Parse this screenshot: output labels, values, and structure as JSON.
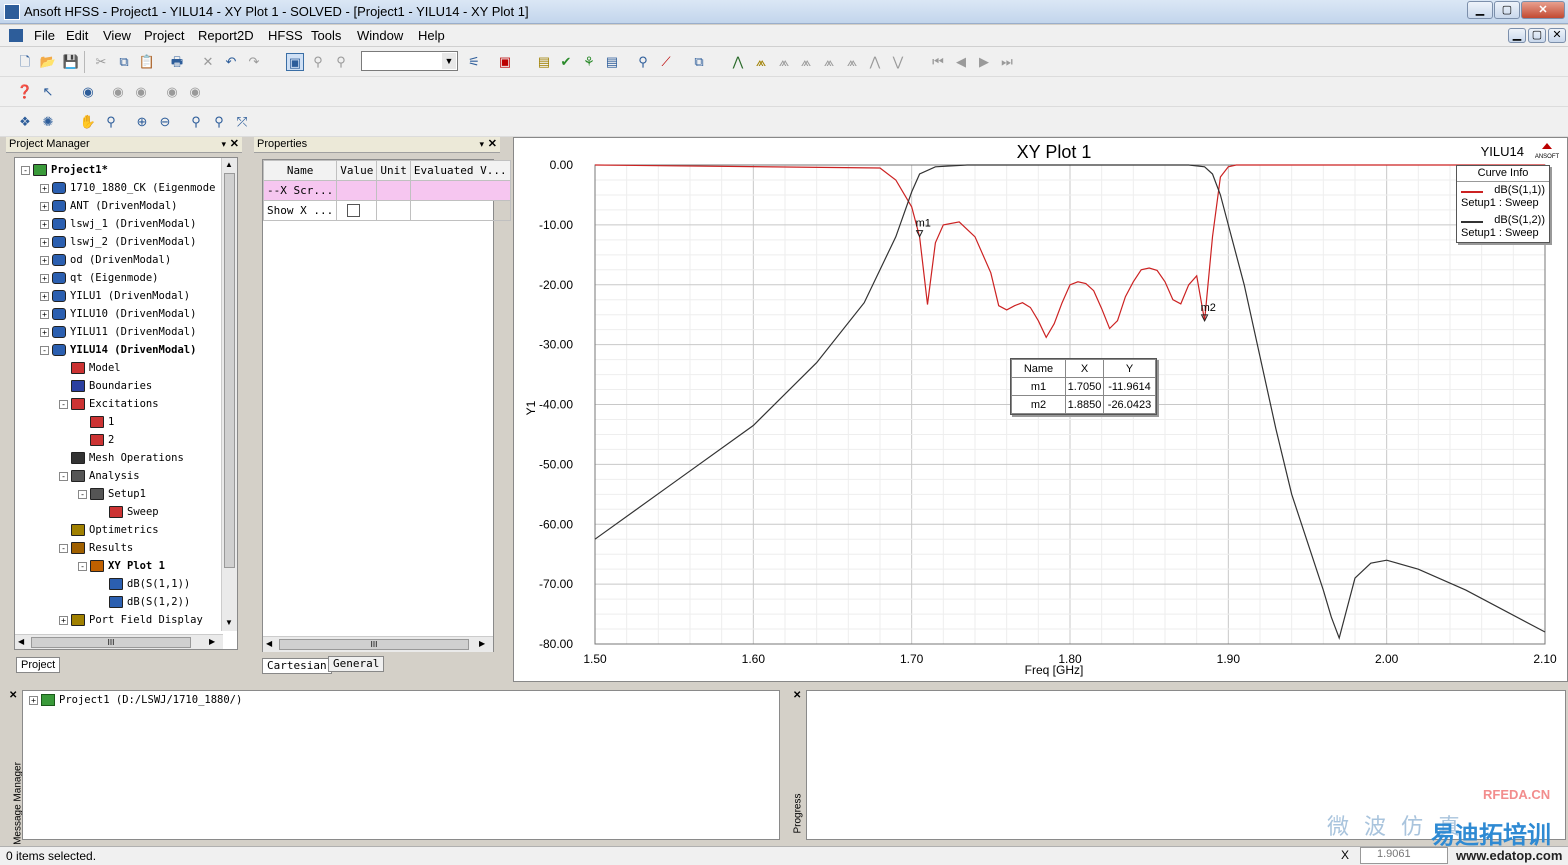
{
  "window": {
    "title": "Ansoft HFSS - Project1 - YILU14 - XY Plot 1 - SOLVED - [Project1 - YILU14 - XY Plot 1]"
  },
  "menu": [
    "File",
    "Edit",
    "View",
    "Project",
    "Report2D",
    "HFSS",
    "Tools",
    "Window",
    "Help"
  ],
  "project_manager": {
    "title": "Project Manager",
    "tab": "Project",
    "items": [
      {
        "label": "Project1*",
        "bold": true,
        "level": 0,
        "exp": "-"
      },
      {
        "label": "1710_1880_CK (Eigenmode",
        "level": 1,
        "exp": "+"
      },
      {
        "label": "ANT (DrivenModal)",
        "level": 1,
        "exp": "+"
      },
      {
        "label": "lswj_1 (DrivenModal)",
        "level": 1,
        "exp": "+"
      },
      {
        "label": "lswj_2 (DrivenModal)",
        "level": 1,
        "exp": "+"
      },
      {
        "label": "od (DrivenModal)",
        "level": 1,
        "exp": "+"
      },
      {
        "label": "qt (Eigenmode)",
        "level": 1,
        "exp": "+"
      },
      {
        "label": "YILU1 (DrivenModal)",
        "level": 1,
        "exp": "+"
      },
      {
        "label": "YILU10 (DrivenModal)",
        "level": 1,
        "exp": "+"
      },
      {
        "label": "YILU11 (DrivenModal)",
        "level": 1,
        "exp": "+"
      },
      {
        "label": "YILU14 (DrivenModal)",
        "bold": true,
        "level": 1,
        "exp": "-"
      },
      {
        "label": "Model",
        "level": 2,
        "exp": ""
      },
      {
        "label": "Boundaries",
        "level": 2,
        "exp": ""
      },
      {
        "label": "Excitations",
        "level": 2,
        "exp": "-"
      },
      {
        "label": "1",
        "level": 3,
        "exp": ""
      },
      {
        "label": "2",
        "level": 3,
        "exp": ""
      },
      {
        "label": "Mesh Operations",
        "level": 2,
        "exp": ""
      },
      {
        "label": "Analysis",
        "level": 2,
        "exp": "-"
      },
      {
        "label": "Setup1",
        "level": 3,
        "exp": "-"
      },
      {
        "label": "Sweep",
        "level": 4,
        "exp": ""
      },
      {
        "label": "Optimetrics",
        "level": 2,
        "exp": ""
      },
      {
        "label": "Results",
        "level": 2,
        "exp": "-"
      },
      {
        "label": "XY Plot 1",
        "bold": true,
        "level": 3,
        "exp": "-"
      },
      {
        "label": "dB(S(1,1))",
        "level": 4,
        "exp": ""
      },
      {
        "label": "dB(S(1,2))",
        "level": 4,
        "exp": ""
      },
      {
        "label": "Port Field Display",
        "level": 2,
        "exp": "+"
      }
    ],
    "hscroll_label": "III"
  },
  "properties": {
    "title": "Properties",
    "columns": [
      "Name",
      "Value",
      "Unit",
      "Evaluated V..."
    ],
    "rows": [
      [
        "--X Scr...",
        "",
        "",
        ""
      ],
      [
        "Show X ...",
        "",
        "",
        ""
      ]
    ],
    "tabs": [
      "Cartesian",
      "General"
    ],
    "hscroll_label": "III"
  },
  "plot": {
    "title": "XY Plot 1",
    "design": "YILU14",
    "logo": "ANSOFT",
    "xlabel": "Freq [GHz]",
    "ylabel": "Y1",
    "xticks": [
      "1.50",
      "1.60",
      "1.70",
      "1.80",
      "1.90",
      "2.00",
      "2.10"
    ],
    "yticks": [
      "0.00",
      "-10.00",
      "-20.00",
      "-30.00",
      "-40.00",
      "-50.00",
      "-60.00",
      "-70.00",
      "-80.00"
    ],
    "legend": {
      "title": "Curve Info",
      "entries": [
        {
          "name": "dB(S(1,1))",
          "sub": "Setup1 : Sweep",
          "color": "#cc2222"
        },
        {
          "name": "dB(S(1,2))",
          "sub": "Setup1 : Sweep",
          "color": "#333333"
        }
      ]
    },
    "marker_table": {
      "columns": [
        "Name",
        "X",
        "Y"
      ],
      "rows": [
        [
          "m1",
          "1.7050",
          "-11.9614"
        ],
        [
          "m2",
          "1.8850",
          "-26.0423"
        ]
      ]
    },
    "markers": [
      {
        "name": "m1"
      },
      {
        "name": "m2"
      }
    ]
  },
  "chart_data": {
    "type": "line",
    "title": "XY Plot 1",
    "xlabel": "Freq [GHz]",
    "ylabel": "Y1",
    "xlim": [
      1.5,
      2.1
    ],
    "ylim": [
      -80,
      0
    ],
    "series": [
      {
        "name": "dB(S(1,1))",
        "color": "#cc2222",
        "x": [
          1.5,
          1.68,
          1.69,
          1.7,
          1.705,
          1.71,
          1.715,
          1.72,
          1.73,
          1.74,
          1.75,
          1.755,
          1.76,
          1.765,
          1.77,
          1.775,
          1.78,
          1.785,
          1.79,
          1.795,
          1.8,
          1.805,
          1.81,
          1.815,
          1.82,
          1.825,
          1.83,
          1.835,
          1.84,
          1.845,
          1.85,
          1.855,
          1.86,
          1.865,
          1.87,
          1.875,
          1.88,
          1.885,
          1.89,
          1.895,
          1.9,
          1.905,
          2.1
        ],
        "y": [
          0,
          -0.5,
          -2.5,
          -7,
          -12,
          -23.3,
          -13,
          -10,
          -9.5,
          -12,
          -18,
          -23.5,
          -24.2,
          -23.5,
          -23,
          -23.8,
          -26,
          -28.8,
          -26.5,
          -23,
          -20,
          -19.5,
          -19.8,
          -21,
          -24,
          -27.3,
          -26,
          -22,
          -19.5,
          -17.5,
          -17.2,
          -17.6,
          -19.5,
          -22.5,
          -23.2,
          -20,
          -18.5,
          -26,
          -12,
          -2,
          -0.3,
          0,
          0
        ]
      },
      {
        "name": "dB(S(1,2))",
        "color": "#333333",
        "x": [
          1.5,
          1.55,
          1.6,
          1.64,
          1.67,
          1.69,
          1.7,
          1.705,
          1.715,
          1.735,
          1.875,
          1.885,
          1.89,
          1.895,
          1.9,
          1.91,
          1.92,
          1.93,
          1.94,
          1.95,
          1.96,
          1.965,
          1.97,
          1.98,
          1.99,
          2.0,
          2.02,
          2.05,
          2.1
        ],
        "y": [
          -62.5,
          -53,
          -43.5,
          -33,
          -23,
          -12,
          -4.5,
          -1.5,
          -0.3,
          0,
          0,
          -0.3,
          -1.5,
          -5,
          -10,
          -20,
          -32,
          -44,
          -55,
          -63,
          -71,
          -75.5,
          -79,
          -69,
          -66.5,
          -66,
          -67.5,
          -71,
          -78
        ]
      }
    ]
  },
  "message_manager": {
    "label": "Message Manager",
    "item": "Project1 (D:/LSWJ/1710_1880/)"
  },
  "progress": {
    "label": "Progress"
  },
  "status": {
    "text": "0 items selected.",
    "coord": "1.9061"
  },
  "watermark": {
    "cn1": "微 波 仿 真",
    "cn2": "易迪拓培训",
    "site": "RFEDA.CN",
    "url": "www.edatop.com"
  }
}
